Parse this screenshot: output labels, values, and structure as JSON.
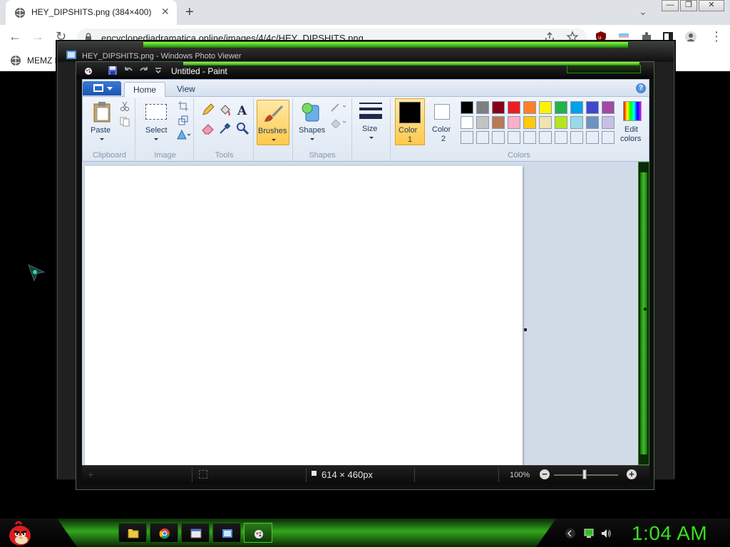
{
  "browser": {
    "tab_title": "HEY_DIPSHITS.png (384×400)",
    "tab_close": "✕",
    "new_tab": "+",
    "tab_search": "⌄",
    "window_minimize": "—",
    "window_restore": "❐",
    "window_close": "✕",
    "url": "encyclopediadramatica.online/images/4/4c/HEY_DIPSHITS.png",
    "bookmark_label": "MEMZ D",
    "nav_back": "←",
    "nav_forward": "→",
    "nav_reload": "↻",
    "menu": "⋮"
  },
  "photo_viewer": {
    "title": "HEY_DIPSHITS.png - Windows Photo Viewer"
  },
  "paint": {
    "title": "Untitled - Paint",
    "tabs": {
      "home": "Home",
      "view": "View"
    },
    "help": "?",
    "groups": {
      "clipboard": {
        "label": "Clipboard",
        "paste": "Paste"
      },
      "image": {
        "label": "Image",
        "select": "Select"
      },
      "tools": {
        "label": "Tools"
      },
      "brushes": {
        "label": "Brushes"
      },
      "shapes": {
        "label": "Shapes",
        "shapes": "Shapes"
      },
      "size": {
        "label": "Size"
      },
      "colors": {
        "label": "Colors",
        "color1": "Color",
        "color1_num": "1",
        "color2": "Color",
        "color2_num": "2",
        "edit": "Edit",
        "edit2": "colors",
        "color1_value": "#000000",
        "color2_value": "#ffffff",
        "row1": [
          "#000000",
          "#7f7f7f",
          "#880015",
          "#ed1c24",
          "#ff7f27",
          "#fff200",
          "#22b14c",
          "#00a2e8",
          "#3f48cc",
          "#a349a4"
        ],
        "row2": [
          "#ffffff",
          "#c3c3c3",
          "#b97a57",
          "#ffaec9",
          "#ffc90e",
          "#efe4b0",
          "#b5e61d",
          "#99d9ea",
          "#7092be",
          "#c8bfe7"
        ],
        "row3": [
          "#e8eef6",
          "#e8eef6",
          "#e8eef6",
          "#e8eef6",
          "#e8eef6",
          "#e8eef6",
          "#e8eef6",
          "#e8eef6",
          "#e8eef6",
          "#e8eef6"
        ]
      }
    },
    "status": {
      "canvas_size": "614 × 460px",
      "zoom": "100%",
      "zoom_out": "−",
      "zoom_in": "+"
    }
  },
  "taskbar": {
    "clock": "1:04 AM"
  },
  "colors": {
    "accent_green": "#38e01e",
    "ribbon_blue": "#1e395b"
  }
}
